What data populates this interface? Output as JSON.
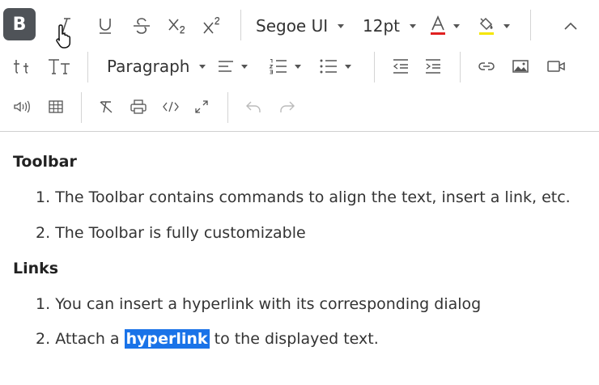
{
  "toolbar": {
    "bold_label": "B",
    "font_name": "Segoe UI",
    "font_size": "12pt",
    "font_color": "#e02020",
    "highlight_color": "#f5e600",
    "format_block": "Paragraph"
  },
  "content": {
    "sections": [
      {
        "heading": "Toolbar",
        "items": [
          {
            "number": "1.",
            "text": "The Toolbar contains commands to align the text, insert a link, etc."
          },
          {
            "number": "2.",
            "text": "The Toolbar is fully customizable"
          }
        ]
      },
      {
        "heading": "Links",
        "items": [
          {
            "number": "1.",
            "text": "You can insert a hyperlink with its corresponding dialog"
          },
          {
            "number": "2.",
            "before": "Attach a ",
            "link": "hyperlink",
            "after": " to the displayed text."
          }
        ]
      }
    ]
  }
}
